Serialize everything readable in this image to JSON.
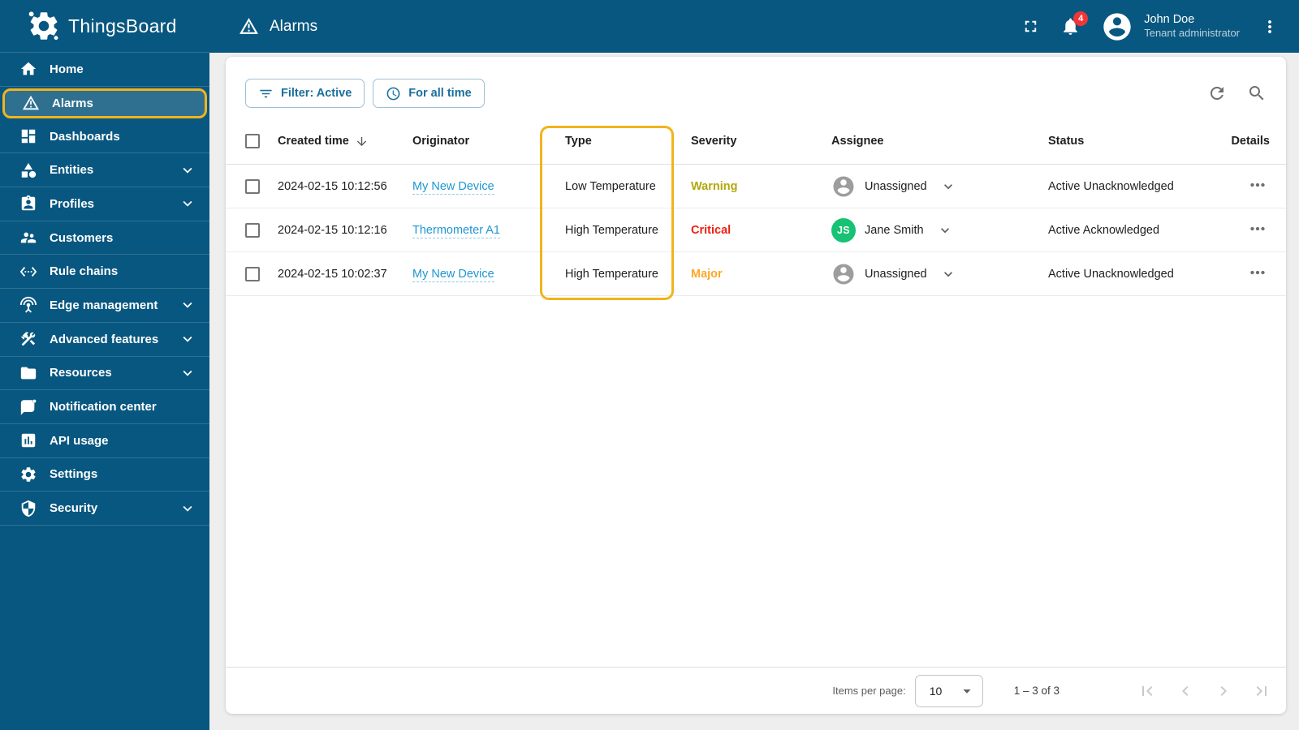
{
  "brand": {
    "name": "ThingsBoard",
    "logo_icon": "thingsboard-logo-icon"
  },
  "topbar": {
    "title": "Alarms",
    "title_icon": "warning-icon",
    "fullscreen_icon": "fullscreen-icon",
    "notifications": {
      "icon": "bell-icon",
      "badge": "4"
    },
    "user": {
      "name": "John Doe",
      "role": "Tenant administrator",
      "avatar_icon": "person-icon"
    },
    "menu_icon": "kebab-menu-icon"
  },
  "sidebar": {
    "items": [
      {
        "label": "Home",
        "icon": "home-icon",
        "active": false,
        "expandable": false
      },
      {
        "label": "Alarms",
        "icon": "warning-icon",
        "active": true,
        "expandable": false
      },
      {
        "label": "Dashboards",
        "icon": "dashboards-icon",
        "active": false,
        "expandable": false
      },
      {
        "label": "Entities",
        "icon": "entities-icon",
        "active": false,
        "expandable": true
      },
      {
        "label": "Profiles",
        "icon": "profiles-icon",
        "active": false,
        "expandable": true
      },
      {
        "label": "Customers",
        "icon": "customers-icon",
        "active": false,
        "expandable": false
      },
      {
        "label": "Rule chains",
        "icon": "rule-chains-icon",
        "active": false,
        "expandable": false
      },
      {
        "label": "Edge management",
        "icon": "edge-management-icon",
        "active": false,
        "expandable": true
      },
      {
        "label": "Advanced features",
        "icon": "advanced-features-icon",
        "active": false,
        "expandable": true
      },
      {
        "label": "Resources",
        "icon": "resources-icon",
        "active": false,
        "expandable": true
      },
      {
        "label": "Notification center",
        "icon": "notification-center-icon",
        "active": false,
        "expandable": false
      },
      {
        "label": "API usage",
        "icon": "api-usage-icon",
        "active": false,
        "expandable": false
      },
      {
        "label": "Settings",
        "icon": "settings-icon",
        "active": false,
        "expandable": false
      },
      {
        "label": "Security",
        "icon": "security-icon",
        "active": false,
        "expandable": true
      }
    ]
  },
  "toolbar": {
    "filter_button": {
      "label": "Filter: Active",
      "icon": "filter-icon"
    },
    "time_button": {
      "label": "For all time",
      "icon": "clock-icon"
    },
    "refresh_icon": "refresh-icon",
    "search_icon": "search-icon"
  },
  "table": {
    "columns": {
      "created_time": "Created time",
      "originator": "Originator",
      "type": "Type",
      "severity": "Severity",
      "assignee": "Assignee",
      "status": "Status",
      "details": "Details"
    },
    "sort": {
      "column": "Created time",
      "direction": "desc"
    },
    "highlight": {
      "column": "Type",
      "border_color": "#f2b41c"
    },
    "rows": [
      {
        "created_time": "2024-02-15 10:12:56",
        "originator": "My New Device",
        "type": "Low Temperature",
        "severity": "Warning",
        "severity_color": "#b3a70b",
        "assignee": {
          "label": "Unassigned",
          "initials": null,
          "color": null
        },
        "status": "Active Unacknowledged"
      },
      {
        "created_time": "2024-02-15 10:12:16",
        "originator": "Thermometer A1",
        "type": "High Temperature",
        "severity": "Critical",
        "severity_color": "#ef2012",
        "assignee": {
          "label": "Jane Smith",
          "initials": "JS",
          "color": "#16c273"
        },
        "status": "Active Acknowledged"
      },
      {
        "created_time": "2024-02-15 10:02:37",
        "originator": "My New Device",
        "type": "High Temperature",
        "severity": "Major",
        "severity_color": "#ffa726",
        "assignee": {
          "label": "Unassigned",
          "initials": null,
          "color": null
        },
        "status": "Active Unacknowledged"
      }
    ]
  },
  "pagination": {
    "items_per_page_label": "Items per page:",
    "page_size": "10",
    "range": "1 – 3 of 3"
  },
  "colors": {
    "sidebar_bg": "#085780",
    "active_item_bg": "#2f7090",
    "highlight_amber": "#f2b41c",
    "link_blue": "#1e96d2",
    "badge_red": "#f13637",
    "severity_warning": "#b3a70b",
    "severity_critical": "#ef2012",
    "severity_major": "#ffa726",
    "assignee_green": "#16c273"
  }
}
